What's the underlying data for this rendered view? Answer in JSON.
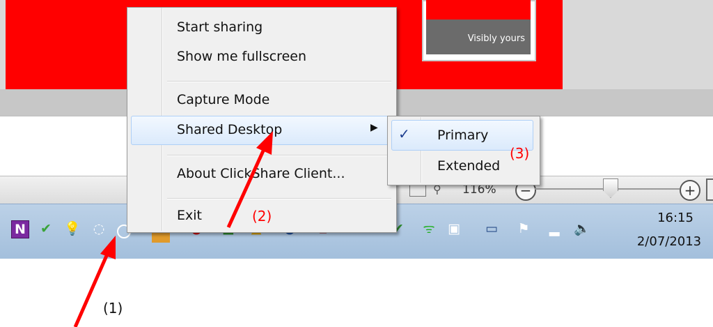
{
  "background_app": {
    "slogan": "Visibly yours",
    "zoom_level": "116%",
    "zoom_minus": "−",
    "zoom_plus": "+"
  },
  "context_menu": {
    "items": [
      {
        "label": "Start sharing"
      },
      {
        "label": "Show me fullscreen"
      },
      {
        "label": "Capture Mode"
      },
      {
        "label": "Shared Desktop",
        "has_submenu": true,
        "highlighted": true
      },
      {
        "label": "About ClickShare Client..."
      },
      {
        "label": "Exit"
      }
    ],
    "submenu_arrow": "▶"
  },
  "submenu": {
    "items": [
      {
        "label": "Primary",
        "checked": true,
        "highlighted": true
      },
      {
        "label": "Extended",
        "checked": false
      }
    ],
    "check_mark": "✓"
  },
  "taskbar": {
    "clock_time": "16:15",
    "clock_date": "2/07/2013",
    "onenote_letter": "N"
  },
  "annotations": {
    "label_1": "(1)",
    "label_2": "(2)",
    "label_3": "(3)"
  },
  "colors": {
    "annotation": "#ff0000",
    "banner": "#ff0000",
    "menu_highlight": "#dbeafc"
  }
}
